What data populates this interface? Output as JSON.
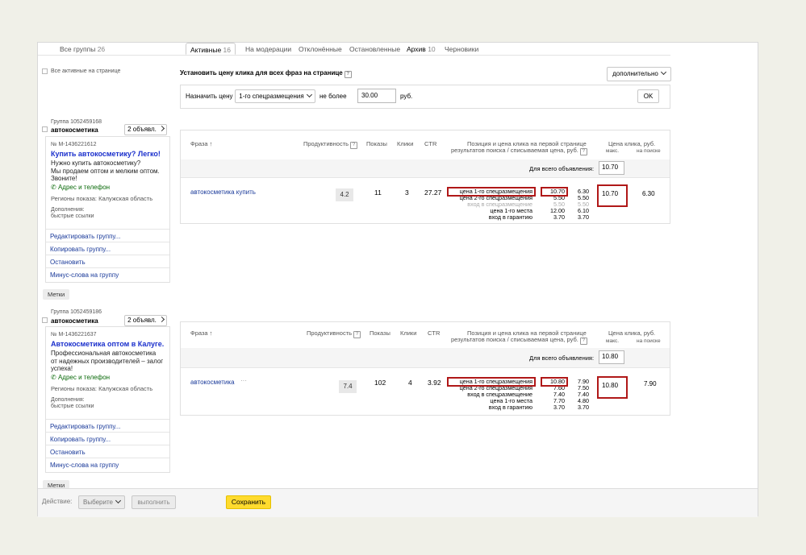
{
  "tabs": {
    "all_groups": {
      "label": "Все группы",
      "count": "26"
    },
    "active": {
      "label": "Активные",
      "count": "16"
    },
    "moderation": {
      "label": "На модерации"
    },
    "rejected": {
      "label": "Отклонённые"
    },
    "stopped": {
      "label": "Остановленные"
    },
    "archive": {
      "label": "Архив",
      "count": "10"
    },
    "drafts": {
      "label": "Черновики"
    }
  },
  "sidebar": {
    "all_active_label": "Все активные на странице"
  },
  "toolbar": {
    "set_price_heading": "Установить цену клика для всех фраз на странице",
    "extra_label": "дополнительно",
    "assign_label": "Назначить цену",
    "position_select": "1-го спецразмещения",
    "no_more_label": "не более",
    "price_value": "30.00",
    "currency": "руб.",
    "ok_label": "OK"
  },
  "groups": [
    {
      "group_label": "Группа 1052459168",
      "name": "автокосметика",
      "ads_button": "2 объявл.",
      "ad_id": "№ М-1436221612",
      "ad_title": "Купить автокосметику? Легко!",
      "ad_text": [
        "Нужно купить автокосметику?",
        "Мы продаем оптом и мелким оптом.",
        "Звоните!"
      ],
      "address_link": "Адрес и телефон",
      "regions": "Регионы показа: Калужская область",
      "extras_label": "Дополнения:",
      "extras_value": "быстрые ссылки",
      "actions": [
        "Редактировать группу...",
        "Копировать группу...",
        "Остановить",
        "Минус-слова на группу"
      ],
      "tags_label": "Метки",
      "table": {
        "headers": {
          "phrase": "Фраза ↑",
          "productivity": "Продуктивность",
          "shows": "Показы",
          "clicks": "Клики",
          "ctr": "CTR",
          "position_line1": "Позиция и цена клика на первой странице",
          "position_line2": "результатов поиска / списываемая цена, руб.",
          "price_title": "Цена клика, руб.",
          "max": "макс.",
          "on_search": "на поиске"
        },
        "all_ad_label": "Для всего объявления:",
        "all_ad_value": "10.70",
        "row": {
          "phrase": "автокосметика купить",
          "show_more": false,
          "productivity": "4.2",
          "shows": "11",
          "clicks": "3",
          "ctr": "27.27",
          "positions": [
            {
              "label": "цена 1-го спецразмещения",
              "bid": "10.70",
              "charge": "6.30",
              "muted": false
            },
            {
              "label": "цена 2-го спецразмещения",
              "bid": "5.50",
              "charge": "5.50",
              "muted": false
            },
            {
              "label": "вход в спецразмещение",
              "bid": "5.50",
              "charge": "5.50",
              "muted": true
            },
            {
              "label": "цена 1-го места",
              "bid": "12.00",
              "charge": "6.10",
              "muted": false
            },
            {
              "label": "вход в гарантию",
              "bid": "3.70",
              "charge": "3.70",
              "muted": false
            }
          ],
          "max_price": "10.70",
          "on_search": "6.30"
        }
      }
    },
    {
      "group_label": "Группа 1052459186",
      "name": "автокосметика",
      "ads_button": "2 объявл.",
      "ad_id": "№ М-1436221637",
      "ad_title": "Автокосметика оптом в Калуге.",
      "ad_text": [
        "Профессиональная автокосметика",
        "от надежных производителей – залог",
        "успеха!"
      ],
      "address_link": "Адрес и телефон",
      "regions": "Регионы показа: Калужская область",
      "extras_label": "Дополнения:",
      "extras_value": "быстрые ссылки",
      "actions": [
        "Редактировать группу...",
        "Копировать группу...",
        "Остановить",
        "Минус-слова на группу"
      ],
      "tags_label": "Метки",
      "table": {
        "headers": {
          "phrase": "Фраза ↑",
          "productivity": "Продуктивность",
          "shows": "Показы",
          "clicks": "Клики",
          "ctr": "CTR",
          "position_line1": "Позиция и цена клика на первой странице",
          "position_line2": "результатов поиска / списываемая цена, руб.",
          "price_title": "Цена клика, руб.",
          "max": "макс.",
          "on_search": "на поиске"
        },
        "all_ad_label": "Для всего объявления:",
        "all_ad_value": "10.80",
        "row": {
          "phrase": "автокосметика",
          "show_more": true,
          "productivity": "7.4",
          "shows": "102",
          "clicks": "4",
          "ctr": "3.92",
          "positions": [
            {
              "label": "цена 1-го спецразмещения",
              "bid": "10.80",
              "charge": "7.90",
              "muted": false
            },
            {
              "label": "цена 2-го спецразмещения",
              "bid": "7.60",
              "charge": "7.50",
              "muted": false
            },
            {
              "label": "вход в спецразмещение",
              "bid": "7.40",
              "charge": "7.40",
              "muted": false
            },
            {
              "label": "цена 1-го места",
              "bid": "7.70",
              "charge": "4.80",
              "muted": false
            },
            {
              "label": "вход в гарантию",
              "bid": "3.70",
              "charge": "3.70",
              "muted": false
            }
          ],
          "max_price": "10.80",
          "on_search": "7.90"
        }
      }
    }
  ],
  "bottom": {
    "action_label": "Действие:",
    "select_label": "Выберите",
    "run_label": "выполнить",
    "save_label": "Сохранить"
  },
  "colors": {
    "accent_red": "#b01818",
    "save_yellow": "#ffdb2e",
    "link_blue": "#1a3a9a"
  }
}
